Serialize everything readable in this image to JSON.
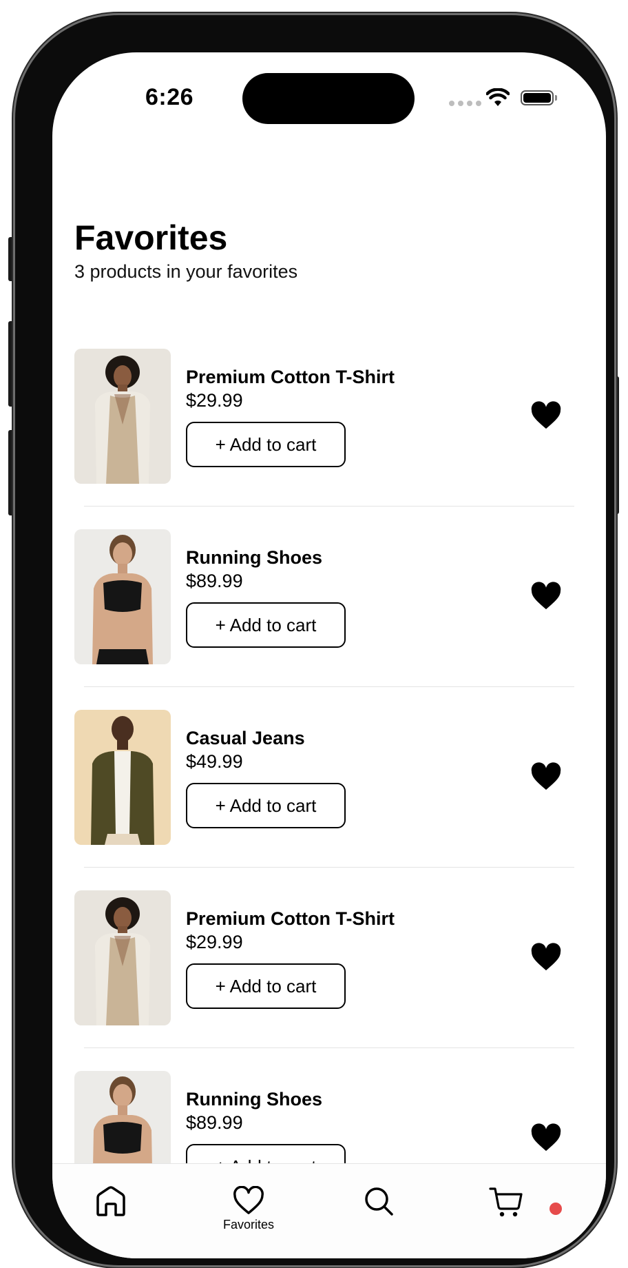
{
  "status_bar": {
    "time": "6:26"
  },
  "header": {
    "title": "Favorites",
    "subtitle": "3 products in your favorites"
  },
  "items": [
    {
      "name": "Premium Cotton T-Shirt",
      "price": "$29.99",
      "button": "+ Add to cart",
      "image": "woman-beige-dress-photo"
    },
    {
      "name": "Running Shoes",
      "price": "$89.99",
      "button": "+ Add to cart",
      "image": "woman-sports-bra-photo"
    },
    {
      "name": "Casual Jeans",
      "price": "$49.99",
      "button": "+ Add to cart",
      "image": "man-olive-blazer-photo"
    },
    {
      "name": "Premium Cotton T-Shirt",
      "price": "$29.99",
      "button": "+ Add to cart",
      "image": "woman-beige-dress-photo"
    },
    {
      "name": "Running Shoes",
      "price": "$89.99",
      "button": "+ Add to cart",
      "image": "woman-sports-bra-photo"
    }
  ],
  "tabbar": {
    "tabs": [
      {
        "icon": "home-icon",
        "label": ""
      },
      {
        "icon": "heart-outline-icon",
        "label": "Favorites",
        "active": true
      },
      {
        "icon": "search-icon",
        "label": ""
      },
      {
        "icon": "cart-icon",
        "label": "",
        "badge": true
      }
    ]
  },
  "colors": {
    "accent": "#000000",
    "badge": "#e64b4b",
    "divider": "#e3e3e3"
  }
}
